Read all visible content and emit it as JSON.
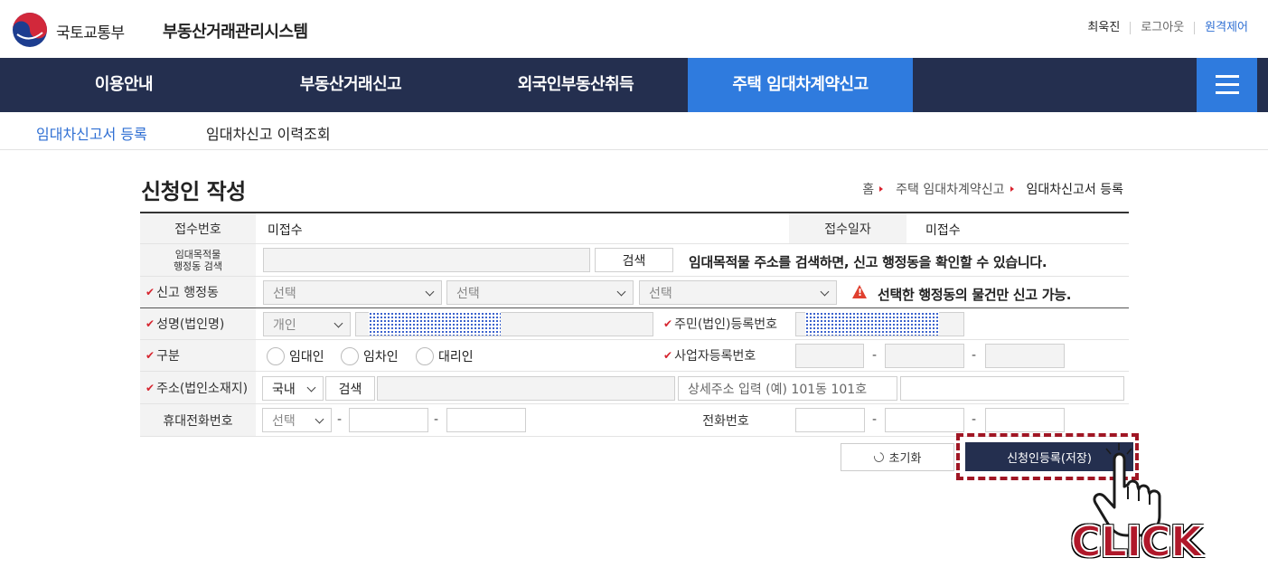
{
  "header": {
    "ministry": "국토교통부",
    "system_name": "부동산거래관리시스템",
    "user_name": "최욱진",
    "logout": "로그아웃",
    "remote": "원격제어"
  },
  "gnb": {
    "items": [
      {
        "label": "이용안내"
      },
      {
        "label": "부동산거래신고"
      },
      {
        "label": "외국인부동산취득"
      },
      {
        "label": "주택 임대차계약신고"
      }
    ],
    "active_index": 3,
    "menu_icon": "hamburger-menu-icon",
    "accent_color": "#2f7bde",
    "bar_color": "#242f4f"
  },
  "lnb": {
    "items": [
      {
        "label": "임대차신고서 등록"
      },
      {
        "label": "임대차신고 이력조회"
      }
    ]
  },
  "page": {
    "title": "신청인 작성",
    "breadcrumb": [
      "홈",
      "주택 임대차계약신고",
      "임대차신고서 등록"
    ]
  },
  "form": {
    "receipt_no_label": "접수번호",
    "receipt_no_value": "미접수",
    "receipt_date_label": "접수일자",
    "receipt_date_value": "미접수",
    "search_label_1": "임대목적물",
    "search_label_2": "행정동 검색",
    "search_button": "검색",
    "search_note": "임대목적물 주소를 검색하면, 신고 행정동을 확인할 수 있습니다.",
    "dong_label": "신고 행정동",
    "select_placeholder": "선택",
    "dong_warning": "선택한 행정동의 물건만 신고 가능.",
    "name_label": "성명(법인명)",
    "name_type": "개인",
    "rrn_label": "주민(법인)등록번호",
    "type_label": "구분",
    "radio_options": [
      "임대인",
      "임차인",
      "대리인"
    ],
    "bizno_label": "사업자등록번호",
    "address_label": "주소(법인소재지)",
    "address_country": "국내",
    "address_search_button": "검색",
    "address_detail_placeholder": "상세주소 입력 (예) 101동 101호",
    "mobile_label": "휴대전화번호",
    "mobile_prefix": "선택",
    "phone_label": "전화번호",
    "dash": "-",
    "required_mark": "✔"
  },
  "actions": {
    "reset": "초기화",
    "save": "신청인등록(저장)"
  },
  "overlay": {
    "click_text": "CLICK",
    "hand_icon": "pointing-hand-cursor-icon"
  }
}
